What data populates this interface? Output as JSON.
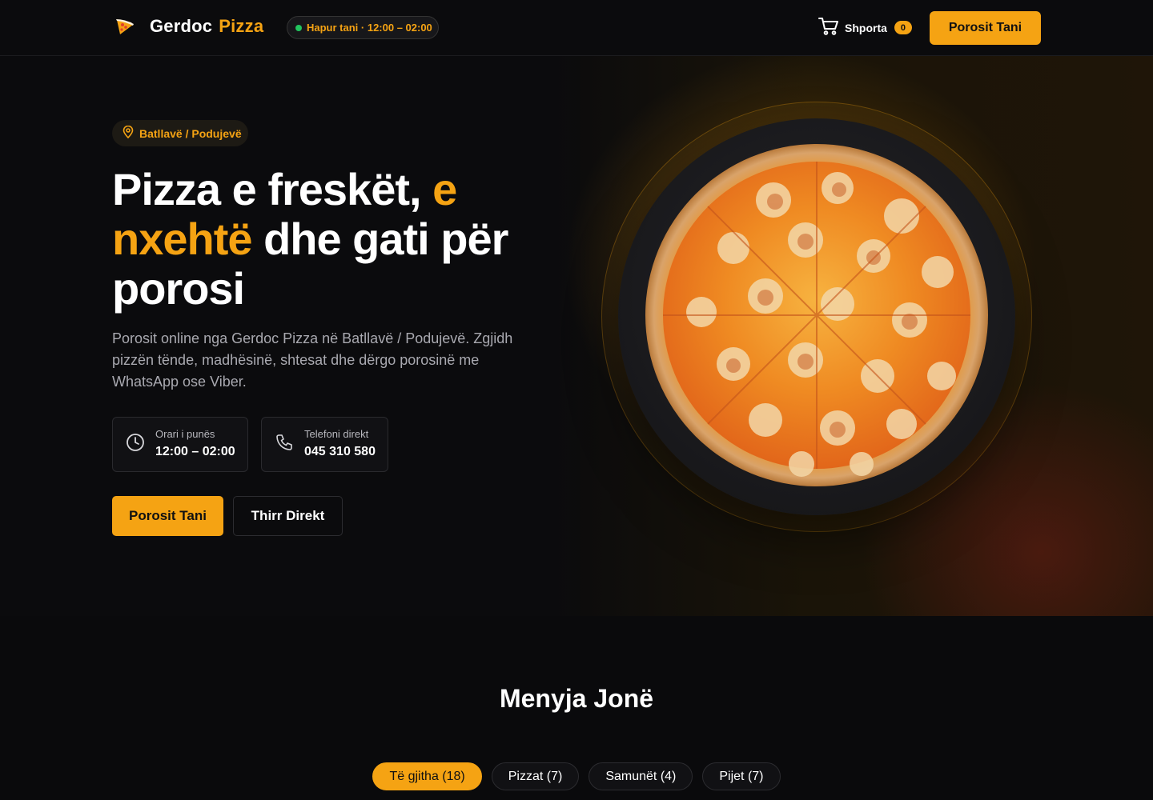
{
  "header": {
    "logo_name": "Gerdoc",
    "logo_accent": "Pizza",
    "logo_icon": "pizza-slice-icon",
    "status_badge": "Hapur tani · 12:00 – 02:00",
    "cart_label": "Shporta",
    "cart_count": "0",
    "cart_icon": "cart-icon",
    "cta_label": "Porosit Tani"
  },
  "hero": {
    "location": "Batllavë / Podujevë",
    "location_icon": "map-pin-icon",
    "title_part1": "Pizza e freskët,",
    "title_accent": "e nxehtë",
    "title_part2": "dhe gati për porosi",
    "description": "Porosit online nga Gerdoc Pizza në Batllavë / Podujevë. Zgjidh pizzën tënde, madhësinë, shtesat dhe dërgo porosinë me WhatsApp ose Viber.",
    "hours_label": "Orari i punës",
    "hours_value": "12:00 – 02:00",
    "hours_icon": "clock-icon",
    "phone_label": "Telefoni direkt",
    "phone_value": "045 310 580",
    "phone_icon": "phone-icon",
    "primary_button": "Porosit Tani",
    "secondary_button": "Thirr Direkt"
  },
  "menu": {
    "title": "Menyja Jonë",
    "tabs": [
      {
        "label": "Të gjitha (18)",
        "active": true
      },
      {
        "label": "Pizzat (7)",
        "active": false
      },
      {
        "label": "Samunët (4)",
        "active": false
      },
      {
        "label": "Pijet (7)",
        "active": false
      }
    ]
  },
  "colors": {
    "accent": "#f5a313",
    "background": "#0a0a0c",
    "status_dot": "#22c55e"
  }
}
